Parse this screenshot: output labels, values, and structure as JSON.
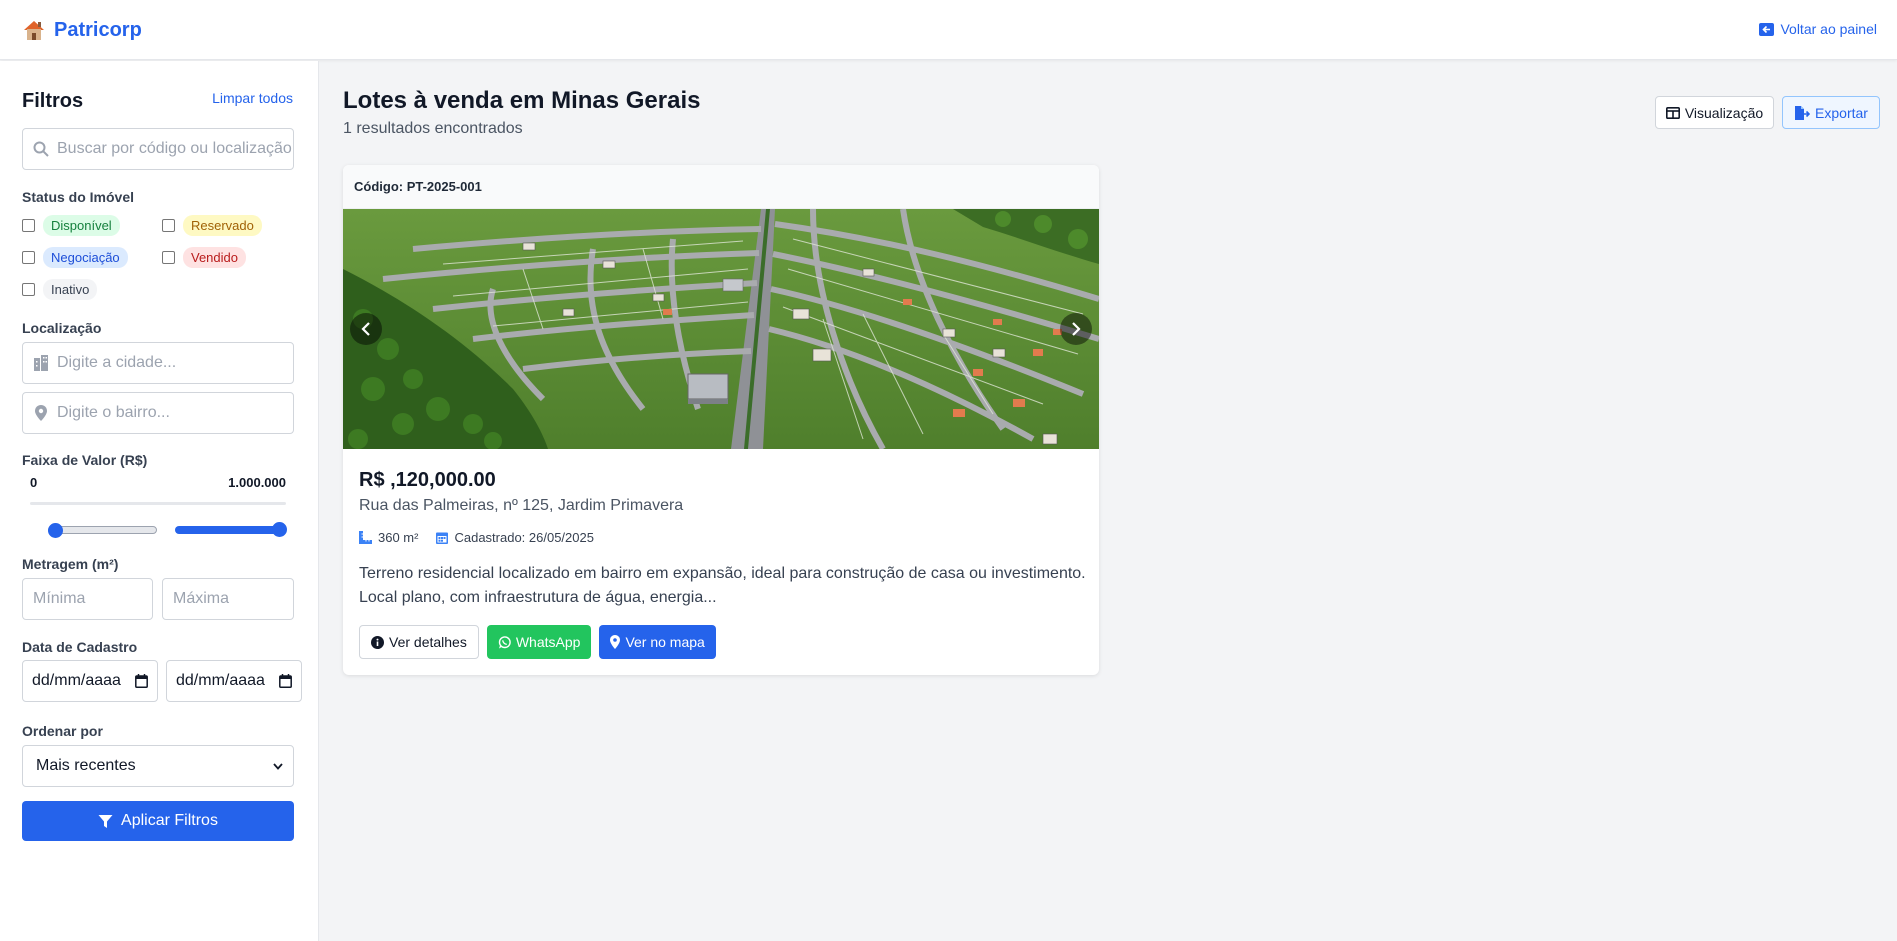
{
  "header": {
    "brand": "Patricorp",
    "back_label": "Voltar ao painel"
  },
  "sidebar": {
    "title": "Filtros",
    "clear_label": "Limpar todos",
    "search_placeholder": "Buscar por código ou localização",
    "status_label": "Status do Imóvel",
    "statuses": [
      "Disponível",
      "Reservado",
      "Negociação",
      "Vendido",
      "Inativo"
    ],
    "location_label": "Localização",
    "city_placeholder": "Digite a cidade...",
    "district_placeholder": "Digite o bairro...",
    "price_label": "Faixa de Valor (R$)",
    "price_min": "0",
    "price_max": "1.000.000",
    "area_label": "Metragem (m²)",
    "area_min_placeholder": "Mínima",
    "area_max_placeholder": "Máxima",
    "date_label": "Data de Cadastro",
    "date_from": "dd/mm/aaaa",
    "date_to": "dd/mm/aaaa",
    "sort_label": "Ordenar por",
    "sort_value": "Mais recentes",
    "apply_label": "Aplicar Filtros"
  },
  "main": {
    "title": "Lotes à venda em Minas Gerais",
    "results": "1 resultados encontrados",
    "view_label": "Visualização",
    "export_label": "Exportar"
  },
  "listing": {
    "code": "Código: PT-2025-001",
    "price": "R$ ,120,000.00",
    "address": "Rua das Palmeiras, nº 125, Jardim Primavera",
    "area": "360 m²",
    "registered": "Cadastrado: 26/05/2025",
    "description": "Terreno residencial localizado em bairro em expansão, ideal para construção de casa ou investimento. Local plano, com infraestrutura de água, energia...",
    "details_label": "Ver detalhes",
    "whatsapp_label": "WhatsApp",
    "map_label": "Ver no mapa"
  },
  "colors": {
    "primary": "#2563eb",
    "whatsapp": "#22c55e",
    "status_disponivel_bg": "#dcfce7",
    "status_reservado_bg": "#fef9c3",
    "status_negociacao_bg": "#dbeafe",
    "status_vendido_bg": "#fee2e2",
    "status_inativo_bg": "#f3f4f6"
  },
  "icons": [
    "house-icon",
    "back-icon",
    "search-icon",
    "building-icon",
    "map-pin-icon",
    "filter-icon",
    "table-icon",
    "export-icon",
    "ruler-icon",
    "calendar-icon",
    "info-icon",
    "whatsapp-icon",
    "chevron-left-icon",
    "chevron-right-icon"
  ]
}
